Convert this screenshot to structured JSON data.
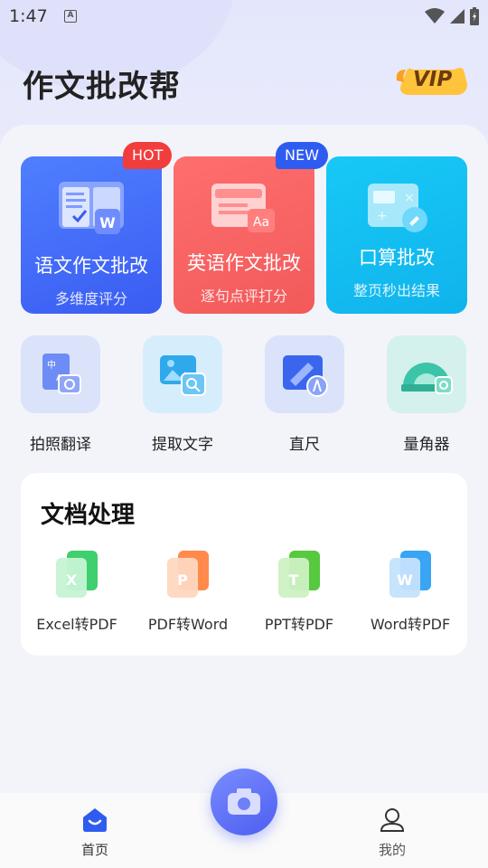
{
  "status_bar": {
    "time": "1:47",
    "notification_icon": "A"
  },
  "header": {
    "title": "作文批改帮",
    "vip_label": "VIP"
  },
  "feature_cards": [
    {
      "title": "语文作文批改",
      "subtitle": "多维度评分",
      "badge": "HOT",
      "color": "#3f66f5"
    },
    {
      "title": "英语作文批改",
      "subtitle": "逐句点评打分",
      "badge": "NEW",
      "color": "#f46060"
    },
    {
      "title": "口算批改",
      "subtitle": "整页秒出结果",
      "color": "#12bdf0"
    }
  ],
  "tools": [
    {
      "label": "拍照翻译",
      "icon": "photo-translate-icon"
    },
    {
      "label": "提取文字",
      "icon": "extract-text-icon"
    },
    {
      "label": "直尺",
      "icon": "ruler-icon"
    },
    {
      "label": "量角器",
      "icon": "protractor-icon"
    }
  ],
  "documents": {
    "title": "文档处理",
    "items": [
      {
        "label": "Excel转PDF",
        "letter": "X",
        "color": "#3fcf6e"
      },
      {
        "label": "PDF转Word",
        "letter": "P",
        "color": "#ff8a4c"
      },
      {
        "label": "PPT转PDF",
        "letter": "T",
        "color": "#56c93e"
      },
      {
        "label": "Word转PDF",
        "letter": "W",
        "color": "#3aa4f5"
      }
    ]
  },
  "bottom_nav": {
    "home": "首页",
    "mine": "我的"
  }
}
